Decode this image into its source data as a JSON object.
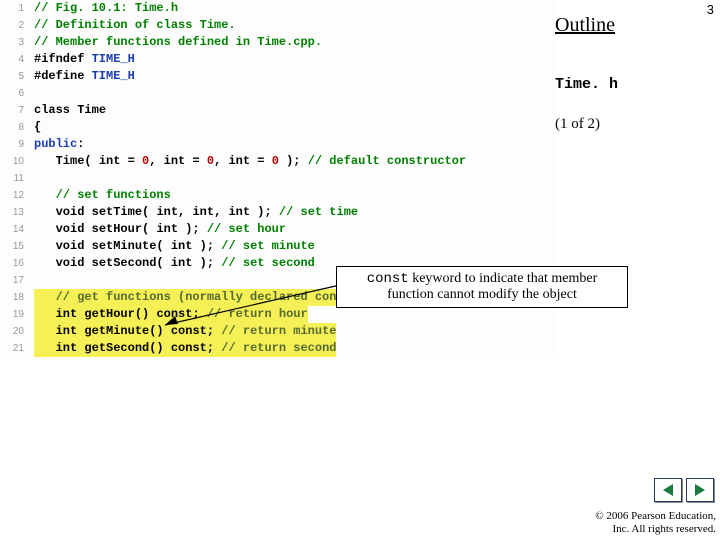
{
  "page_number": "3",
  "outline_label": "Outline",
  "filename": "Time. h",
  "progress": "(1 of 2)",
  "callout_mono": "const",
  "callout_rest": " keyword to indicate that member function cannot modify the object",
  "copyright_line1": "© 2006 Pearson Education,",
  "copyright_line2": "Inc.  All rights reserved.",
  "code": [
    {
      "n": "1",
      "segs": [
        {
          "cls": "c-comment",
          "t": "// Fig. 10.1: Time.h"
        }
      ]
    },
    {
      "n": "2",
      "segs": [
        {
          "cls": "c-comment",
          "t": "// Definition of class Time."
        }
      ]
    },
    {
      "n": "3",
      "segs": [
        {
          "cls": "c-comment",
          "t": "// Member functions defined in Time.cpp."
        }
      ]
    },
    {
      "n": "4",
      "segs": [
        {
          "cls": "c-pp",
          "t": "#ifndef "
        },
        {
          "cls": "c-macro",
          "t": "TIME_H"
        }
      ]
    },
    {
      "n": "5",
      "segs": [
        {
          "cls": "c-pp",
          "t": "#define "
        },
        {
          "cls": "c-macro",
          "t": "TIME_H"
        }
      ]
    },
    {
      "n": "6",
      "segs": [
        {
          "cls": "c-plain",
          "t": " "
        }
      ]
    },
    {
      "n": "7",
      "segs": [
        {
          "cls": "c-kw",
          "t": "class"
        },
        {
          "cls": "c-plain",
          "t": " Time"
        }
      ]
    },
    {
      "n": "8",
      "segs": [
        {
          "cls": "c-plain",
          "t": "{"
        }
      ]
    },
    {
      "n": "9",
      "segs": [
        {
          "cls": "c-type",
          "t": "public"
        },
        {
          "cls": "c-plain",
          "t": ":"
        }
      ]
    },
    {
      "n": "10",
      "segs": [
        {
          "cls": "c-plain",
          "t": "   Time( "
        },
        {
          "cls": "c-kw",
          "t": "int"
        },
        {
          "cls": "c-plain",
          "t": " = "
        },
        {
          "cls": "c-num",
          "t": "0"
        },
        {
          "cls": "c-plain",
          "t": ", "
        },
        {
          "cls": "c-kw",
          "t": "int"
        },
        {
          "cls": "c-plain",
          "t": " = "
        },
        {
          "cls": "c-num",
          "t": "0"
        },
        {
          "cls": "c-plain",
          "t": ", "
        },
        {
          "cls": "c-kw",
          "t": "int"
        },
        {
          "cls": "c-plain",
          "t": " = "
        },
        {
          "cls": "c-num",
          "t": "0"
        },
        {
          "cls": "c-plain",
          "t": " ); "
        },
        {
          "cls": "c-comment",
          "t": "// default constructor"
        }
      ]
    },
    {
      "n": "11",
      "segs": [
        {
          "cls": "c-plain",
          "t": " "
        }
      ]
    },
    {
      "n": "12",
      "segs": [
        {
          "cls": "c-plain",
          "t": "   "
        },
        {
          "cls": "c-comment",
          "t": "// set functions"
        }
      ]
    },
    {
      "n": "13",
      "segs": [
        {
          "cls": "c-plain",
          "t": "   "
        },
        {
          "cls": "c-kw",
          "t": "void"
        },
        {
          "cls": "c-plain",
          "t": " setTime( "
        },
        {
          "cls": "c-kw",
          "t": "int"
        },
        {
          "cls": "c-plain",
          "t": ", "
        },
        {
          "cls": "c-kw",
          "t": "int"
        },
        {
          "cls": "c-plain",
          "t": ", "
        },
        {
          "cls": "c-kw",
          "t": "int"
        },
        {
          "cls": "c-plain",
          "t": " ); "
        },
        {
          "cls": "c-comment",
          "t": "// set time"
        }
      ]
    },
    {
      "n": "14",
      "segs": [
        {
          "cls": "c-plain",
          "t": "   "
        },
        {
          "cls": "c-kw",
          "t": "void"
        },
        {
          "cls": "c-plain",
          "t": " setHour( "
        },
        {
          "cls": "c-kw",
          "t": "int"
        },
        {
          "cls": "c-plain",
          "t": " ); "
        },
        {
          "cls": "c-comment",
          "t": "// set hour"
        }
      ]
    },
    {
      "n": "15",
      "segs": [
        {
          "cls": "c-plain",
          "t": "   "
        },
        {
          "cls": "c-kw",
          "t": "void"
        },
        {
          "cls": "c-plain",
          "t": " setMinute( "
        },
        {
          "cls": "c-kw",
          "t": "int"
        },
        {
          "cls": "c-plain",
          "t": " ); "
        },
        {
          "cls": "c-comment",
          "t": "// set minute"
        }
      ]
    },
    {
      "n": "16",
      "segs": [
        {
          "cls": "c-plain",
          "t": "   "
        },
        {
          "cls": "c-kw",
          "t": "void"
        },
        {
          "cls": "c-plain",
          "t": " setSecond( "
        },
        {
          "cls": "c-kw",
          "t": "int"
        },
        {
          "cls": "c-plain",
          "t": " ); "
        },
        {
          "cls": "c-comment",
          "t": "// set second"
        }
      ]
    },
    {
      "n": "17",
      "segs": [
        {
          "cls": "c-plain",
          "t": " "
        }
      ]
    },
    {
      "n": "18",
      "hl": true,
      "segs": [
        {
          "cls": "c-plain",
          "t": "   "
        },
        {
          "cls": "c-comment2",
          "t": "// get functions (normally declared const)"
        }
      ]
    },
    {
      "n": "19",
      "hl": true,
      "segs": [
        {
          "cls": "c-plain",
          "t": "   "
        },
        {
          "cls": "c-kw",
          "t": "int"
        },
        {
          "cls": "c-plain",
          "t": " getHour() "
        },
        {
          "cls": "c-kw",
          "t": "const"
        },
        {
          "cls": "c-plain",
          "t": "; "
        },
        {
          "cls": "c-comment2",
          "t": "// return hour"
        }
      ]
    },
    {
      "n": "20",
      "hl": true,
      "segs": [
        {
          "cls": "c-plain",
          "t": "   "
        },
        {
          "cls": "c-kw",
          "t": "int"
        },
        {
          "cls": "c-plain",
          "t": " getMinute() "
        },
        {
          "cls": "c-kw",
          "t": "const"
        },
        {
          "cls": "c-plain",
          "t": "; "
        },
        {
          "cls": "c-comment2",
          "t": "// return minute"
        }
      ]
    },
    {
      "n": "21",
      "hl": true,
      "segs": [
        {
          "cls": "c-plain",
          "t": "   "
        },
        {
          "cls": "c-kw",
          "t": "int"
        },
        {
          "cls": "c-plain",
          "t": " getSecond() "
        },
        {
          "cls": "c-kw",
          "t": "const"
        },
        {
          "cls": "c-plain",
          "t": "; "
        },
        {
          "cls": "c-comment2",
          "t": "// return second"
        }
      ]
    }
  ]
}
